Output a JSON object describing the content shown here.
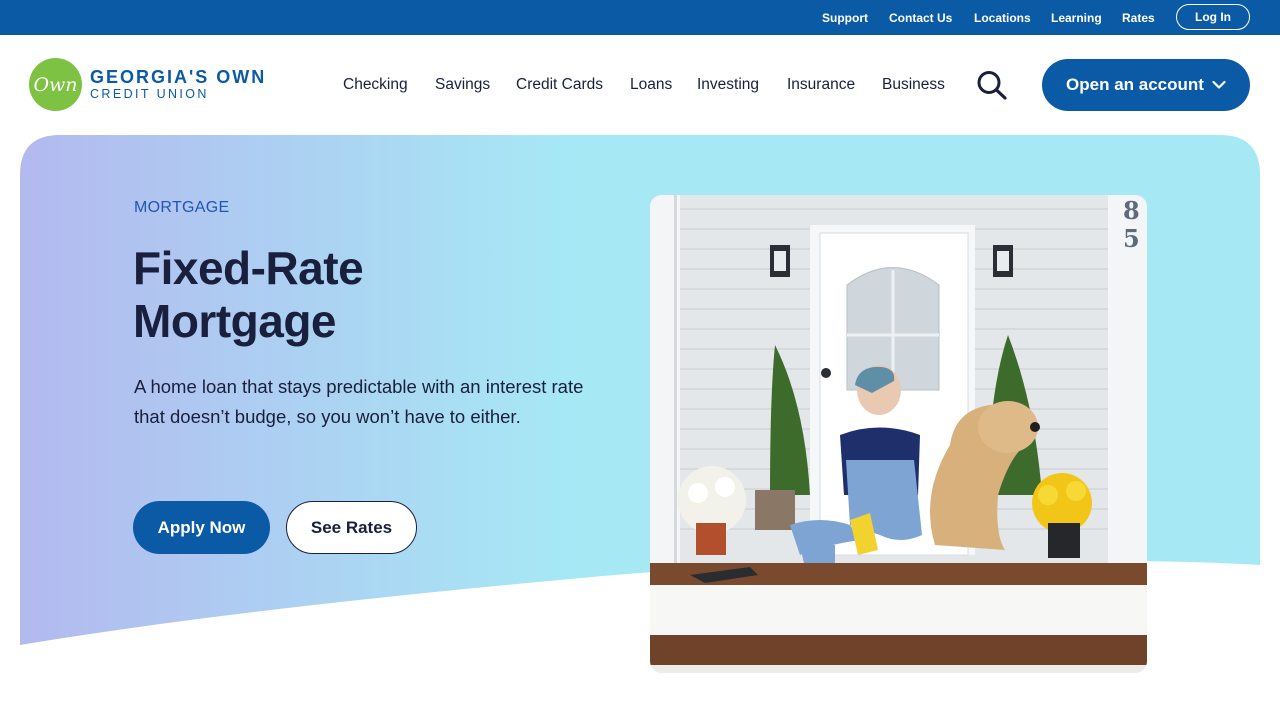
{
  "utility_bar": {
    "links": [
      "Support",
      "Contact Us",
      "Locations",
      "Learning",
      "Rates"
    ],
    "login_label": "Log In"
  },
  "brand": {
    "badge_text": "Own",
    "name": "GEORGIA'S OWN",
    "subtitle": "CREDIT UNION",
    "primary_color": "#0b5aa6",
    "badge_color": "#7dc242"
  },
  "nav": {
    "items": [
      "Checking",
      "Savings",
      "Credit Cards",
      "Loans",
      "Investing",
      "Insurance",
      "Business"
    ],
    "search_icon": "search-icon",
    "open_account_label": "Open an account",
    "open_account_icon": "chevron-down-icon"
  },
  "hero": {
    "eyebrow": "MORTGAGE",
    "title": "Fixed-Rate Mortgage",
    "description": "A home loan that stays predictable with an interest rate that doesn’t budge, so you won’t have to either.",
    "apply_label": "Apply Now",
    "rates_label": "See Rates",
    "house_number": "85",
    "gradient_start": "#b3b9ef",
    "gradient_end": "#a6e9f5",
    "text_color": "#1a1f3d",
    "eyebrow_color": "#1f55b8"
  }
}
